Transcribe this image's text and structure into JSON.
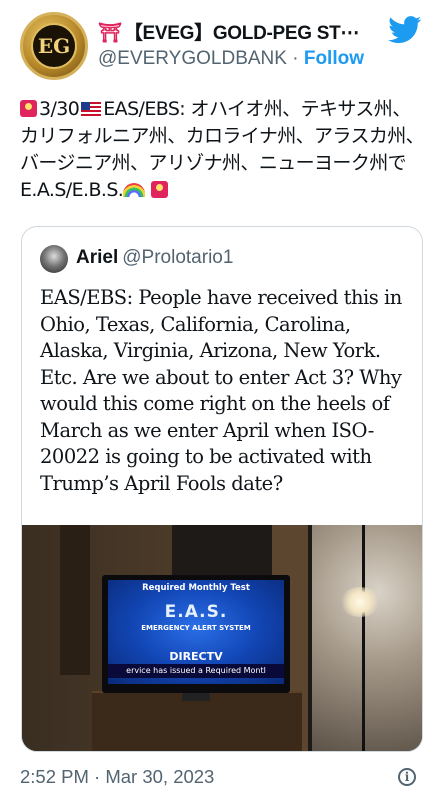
{
  "author": {
    "display_name": "【EVEG】GOLD-PEG ST⋯",
    "handle": "@EVERYGOLDBANK",
    "separator": " · ",
    "follow_label": "Follow",
    "avatar_text": "EG"
  },
  "tweet": {
    "text": "3/30EAS/EBS: オハイオ州、テキサス州、カリフォルニア州、カロライナ州、アラスカ州、バージニア州、アリゾナ州、ニューヨーク州でE.A.S/E.B.S.",
    "text_prefix": "3/30",
    "text_body": "EAS/EBS: オハイオ州、テキサス州、カリフォルニア州、カロライナ州、アラスカ州、バージニア州、アリゾナ州、ニューヨーク州でE.A.S/E.B.S."
  },
  "quoted": {
    "name": "Ariel",
    "handle": "@Prolotario1",
    "text": "EAS/EBS: People have received this in Ohio, Texas, California, Carolina, Alaska, Virginia, Arizona, New York. Etc. Are we about to enter Act 3? Why would this come right on the heels of March as we enter April when ISO-20022 is going to be activated with Trump’s April Fools date?",
    "media": {
      "top_text": "Required Monthly Test",
      "title": "E.A.S.",
      "subtitle": "EMERGENCY ALERT SYSTEM",
      "brand": "DIRECTV",
      "crawl": "ervice has issued a Required Montl"
    }
  },
  "footer": {
    "timestamp": "2:52 PM · Mar 30, 2023",
    "info_icon": "i"
  },
  "colors": {
    "accent": "#1d9bf0",
    "secondary_text": "#536471"
  }
}
